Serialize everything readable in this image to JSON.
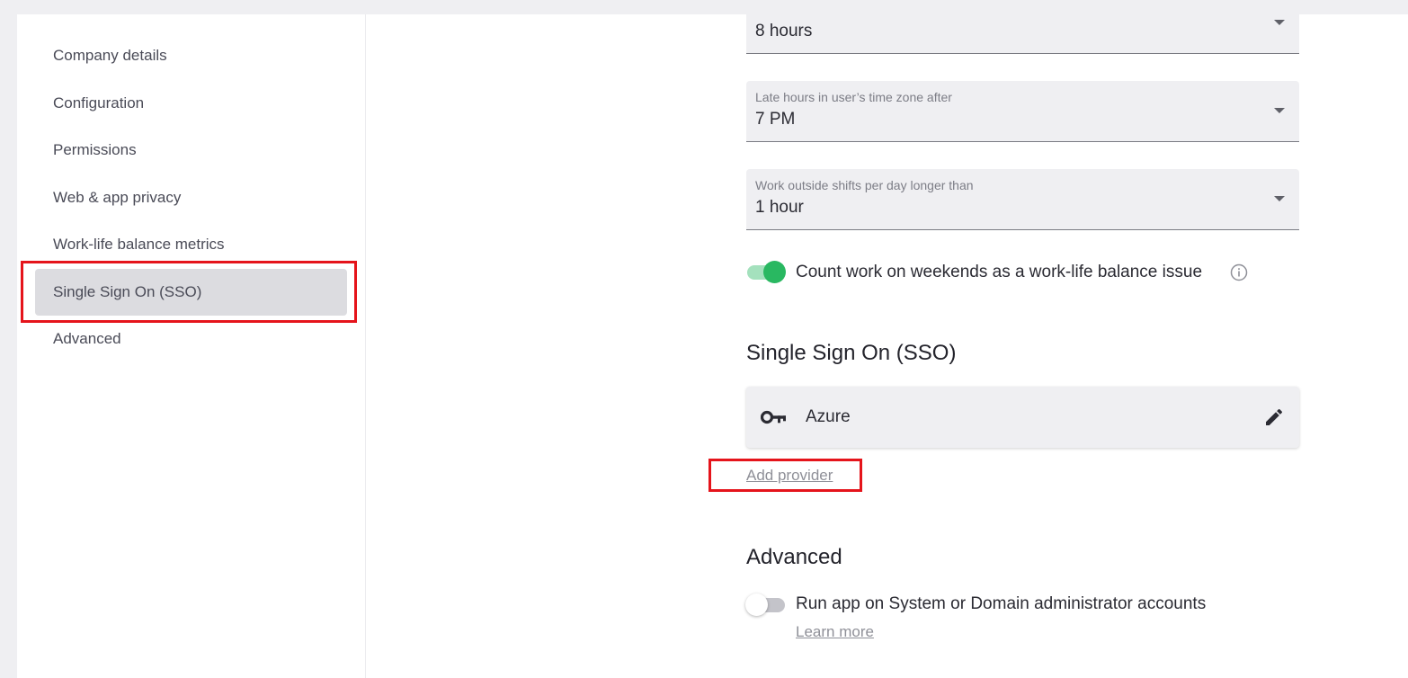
{
  "sidebar": {
    "items": [
      {
        "label": "Company details"
      },
      {
        "label": "Configuration"
      },
      {
        "label": "Permissions"
      },
      {
        "label": "Web & app privacy"
      },
      {
        "label": "Work-life balance metrics"
      },
      {
        "label": "Single Sign On (SSO)",
        "active": true
      },
      {
        "label": "Advanced"
      }
    ]
  },
  "work_life": {
    "field_top": {
      "value": "8 hours"
    },
    "field_late_hours": {
      "label": "Late hours in user’s time zone after",
      "value": "7 PM"
    },
    "field_outside_shifts": {
      "label": "Work outside shifts per day longer than",
      "value": "1 hour"
    },
    "weekend_toggle": {
      "label": "Count work on weekends as a work-life balance issue",
      "on": true
    }
  },
  "sso": {
    "title": "Single Sign On (SSO)",
    "providers": [
      {
        "name": "Azure",
        "icon": "key-icon"
      }
    ],
    "add_provider_label": "Add provider"
  },
  "advanced": {
    "title": "Advanced",
    "admin_toggle": {
      "label": "Run app on System or Domain administrator accounts",
      "on": false
    },
    "learn_more_label": "Learn more"
  },
  "colors": {
    "highlight": "#e5141b",
    "toggle_on": "#29b861",
    "active_nav_bg": "#dcdce0"
  }
}
